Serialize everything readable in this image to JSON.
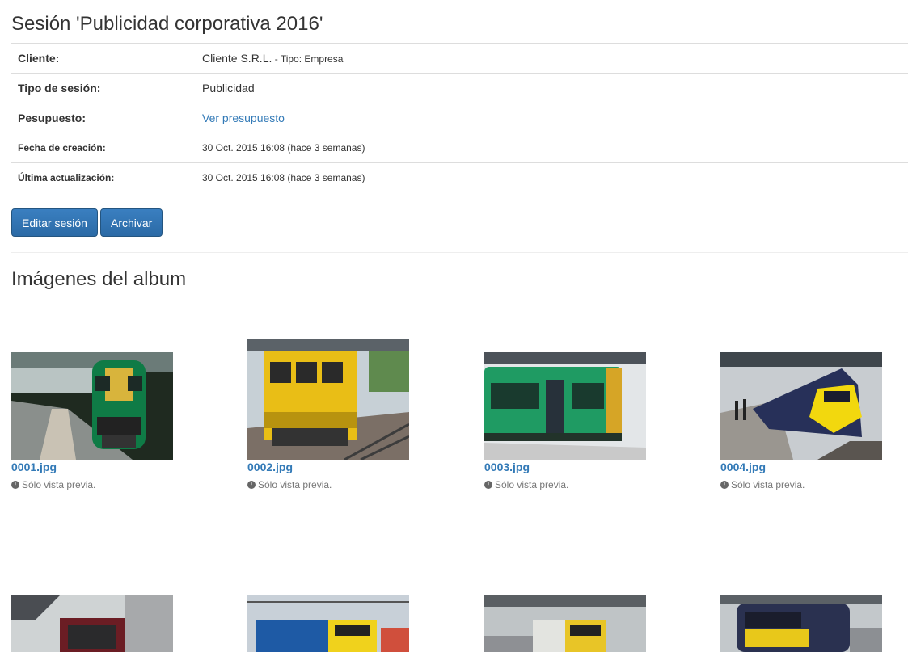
{
  "page": {
    "title": "Sesión 'Publicidad corporativa 2016'"
  },
  "info": {
    "client_label": "Cliente:",
    "client_value": "Cliente S.R.L.",
    "client_type": " - Tipo: Empresa",
    "session_type_label": "Tipo de sesión:",
    "session_type_value": "Publicidad",
    "budget_label": "Pesupuesto:",
    "budget_link": "Ver presupuesto",
    "created_label": "Fecha de creación:",
    "created_value": "30 Oct. 2015 16:08 (hace 3 semanas)",
    "updated_label": "Última actualización:",
    "updated_value": "30 Oct. 2015 16:08 (hace 3 semanas)"
  },
  "actions": {
    "edit_label": "Editar sesión",
    "archive_label": "Archivar"
  },
  "album": {
    "title": "Imágenes del album",
    "note": "Sólo vista previa.",
    "images": [
      {
        "name": "0001.jpg"
      },
      {
        "name": "0002.jpg"
      },
      {
        "name": "0003.jpg"
      },
      {
        "name": "0004.jpg"
      },
      {
        "name": ""
      },
      {
        "name": ""
      },
      {
        "name": ""
      },
      {
        "name": ""
      }
    ]
  },
  "colors": {
    "link": "#337ab7",
    "button": "#2b6aa6"
  }
}
